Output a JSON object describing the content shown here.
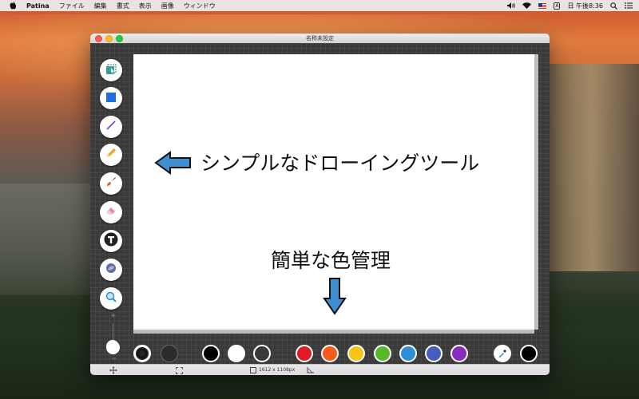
{
  "menubar": {
    "app_name": "Patina",
    "menus": [
      "ファイル",
      "編集",
      "書式",
      "表示",
      "画像",
      "ウィンドウ"
    ],
    "clock": "日 午後8:36"
  },
  "window": {
    "title": "名称未設定"
  },
  "canvas": {
    "annotation_1": "シンプルなドローイングツール",
    "annotation_2": "簡単な色管理"
  },
  "tools": [
    {
      "icon": "select-tool-icon"
    },
    {
      "icon": "shape-tool-icon"
    },
    {
      "icon": "line-tool-icon"
    },
    {
      "icon": "pencil-tool-icon"
    },
    {
      "icon": "brush-tool-icon"
    },
    {
      "icon": "eraser-tool-icon"
    },
    {
      "icon": "text-tool-icon"
    },
    {
      "icon": "fill-tool-icon"
    },
    {
      "icon": "zoom-tool-icon"
    }
  ],
  "colors": {
    "presets": [
      "#000000",
      "#ffffff",
      "#3a3a3a",
      "#e01b24",
      "#f95b1c",
      "#f6c415",
      "#59b72a",
      "#2f8fd6",
      "#4a5cc0",
      "#8a2bc0"
    ],
    "foreground": "#000000",
    "accent": "#3d8fd1"
  },
  "status": {
    "size": "1612 x 1108px"
  }
}
